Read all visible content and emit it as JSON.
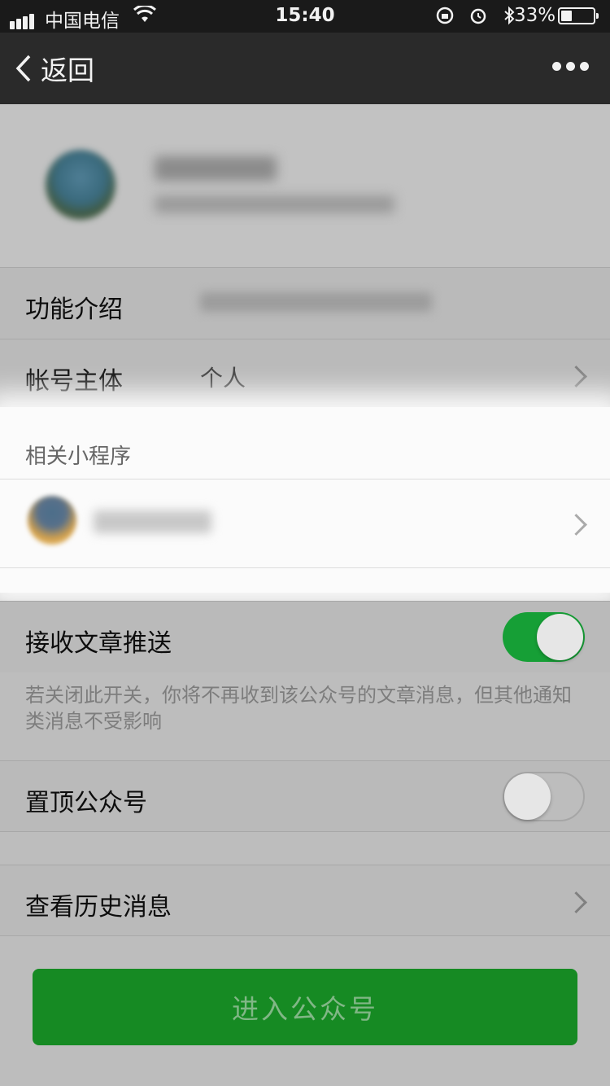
{
  "status_bar": {
    "carrier": "中国电信",
    "time": "15:40",
    "battery_percent": "33%",
    "battery_level": 0.33,
    "icons": [
      "signal-icon",
      "wifi-icon",
      "rotation-lock-icon",
      "alarm-icon",
      "bluetooth-icon",
      "battery-icon"
    ]
  },
  "nav": {
    "back_label": "返回",
    "title": "",
    "more_icon": "more-icon"
  },
  "rows": {
    "intro_label": "功能介绍",
    "account_label": "帐号主体",
    "account_value": "个人",
    "related_title": "相关小程序",
    "receive_label": "接收文章推送",
    "receive_on": true,
    "receive_hint": "若关闭此开关，你将不再收到该公众号的文章消息，但其他通知类消息不受影响",
    "pin_label": "置顶公众号",
    "pin_on": false,
    "history_label": "查看历史消息"
  },
  "enter_button": "进入公众号",
  "colors": {
    "wechat_green": "#169f36",
    "button_green": "#168a23"
  }
}
